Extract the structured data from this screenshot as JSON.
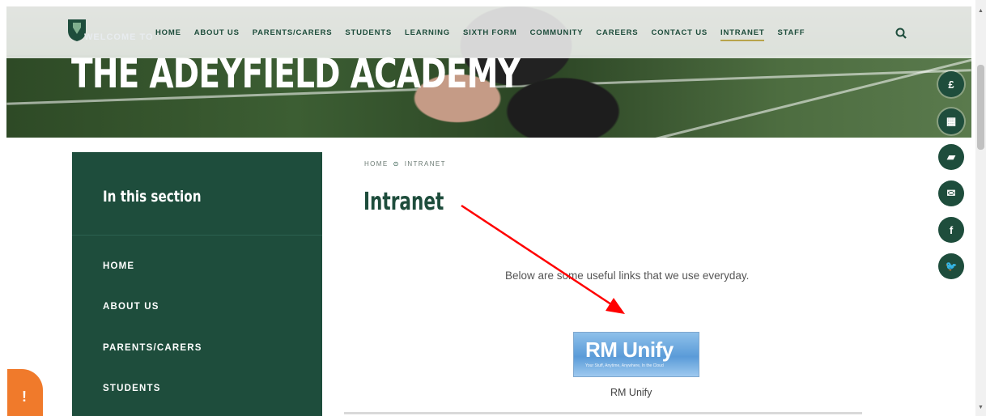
{
  "header": {
    "welcome_prefix": "WELCOME TO",
    "site_title": "THE ADEYFIELD ACADEMY",
    "menu": [
      {
        "label": "HOME"
      },
      {
        "label": "ABOUT US"
      },
      {
        "label": "PARENTS/CARERS"
      },
      {
        "label": "STUDENTS"
      },
      {
        "label": "LEARNING"
      },
      {
        "label": "SIXTH FORM"
      },
      {
        "label": "COMMUNITY"
      },
      {
        "label": "CAREERS"
      },
      {
        "label": "CONTACT US"
      },
      {
        "label": "INTRANET",
        "active": true
      },
      {
        "label": "STAFF"
      }
    ],
    "search_icon": "search-icon"
  },
  "rail": [
    {
      "icon": "pound-icon",
      "glyph": "£"
    },
    {
      "icon": "calendar-icon",
      "glyph": "▦"
    },
    {
      "icon": "book-icon",
      "glyph": "▰"
    },
    {
      "icon": "mail-icon",
      "glyph": "✉"
    },
    {
      "icon": "facebook-icon",
      "glyph": "f"
    },
    {
      "icon": "twitter-icon",
      "glyph": "🐦"
    }
  ],
  "sidebar": {
    "heading": "In this section",
    "items": [
      {
        "label": "HOME"
      },
      {
        "label": "ABOUT US"
      },
      {
        "label": "PARENTS/CARERS"
      },
      {
        "label": "STUDENTS"
      }
    ]
  },
  "main": {
    "breadcrumb": [
      "HOME",
      "INTRANET"
    ],
    "breadcrumb_sep": "⊙",
    "title": "Intranet",
    "intro": "Below are some useful links that we use everyday.",
    "link": {
      "logo_text": "RM Unify",
      "logo_sub": "Your Stuff, Anytime, Anywhere, In the Cloud",
      "caption": "RM Unify"
    }
  },
  "feedback": {
    "glyph": "!"
  },
  "colors": {
    "brand_green": "#1e4d3c",
    "accent_gold": "#b8a44b",
    "feedback_orange": "#f07a2b",
    "arrow_red": "#ff0000"
  }
}
